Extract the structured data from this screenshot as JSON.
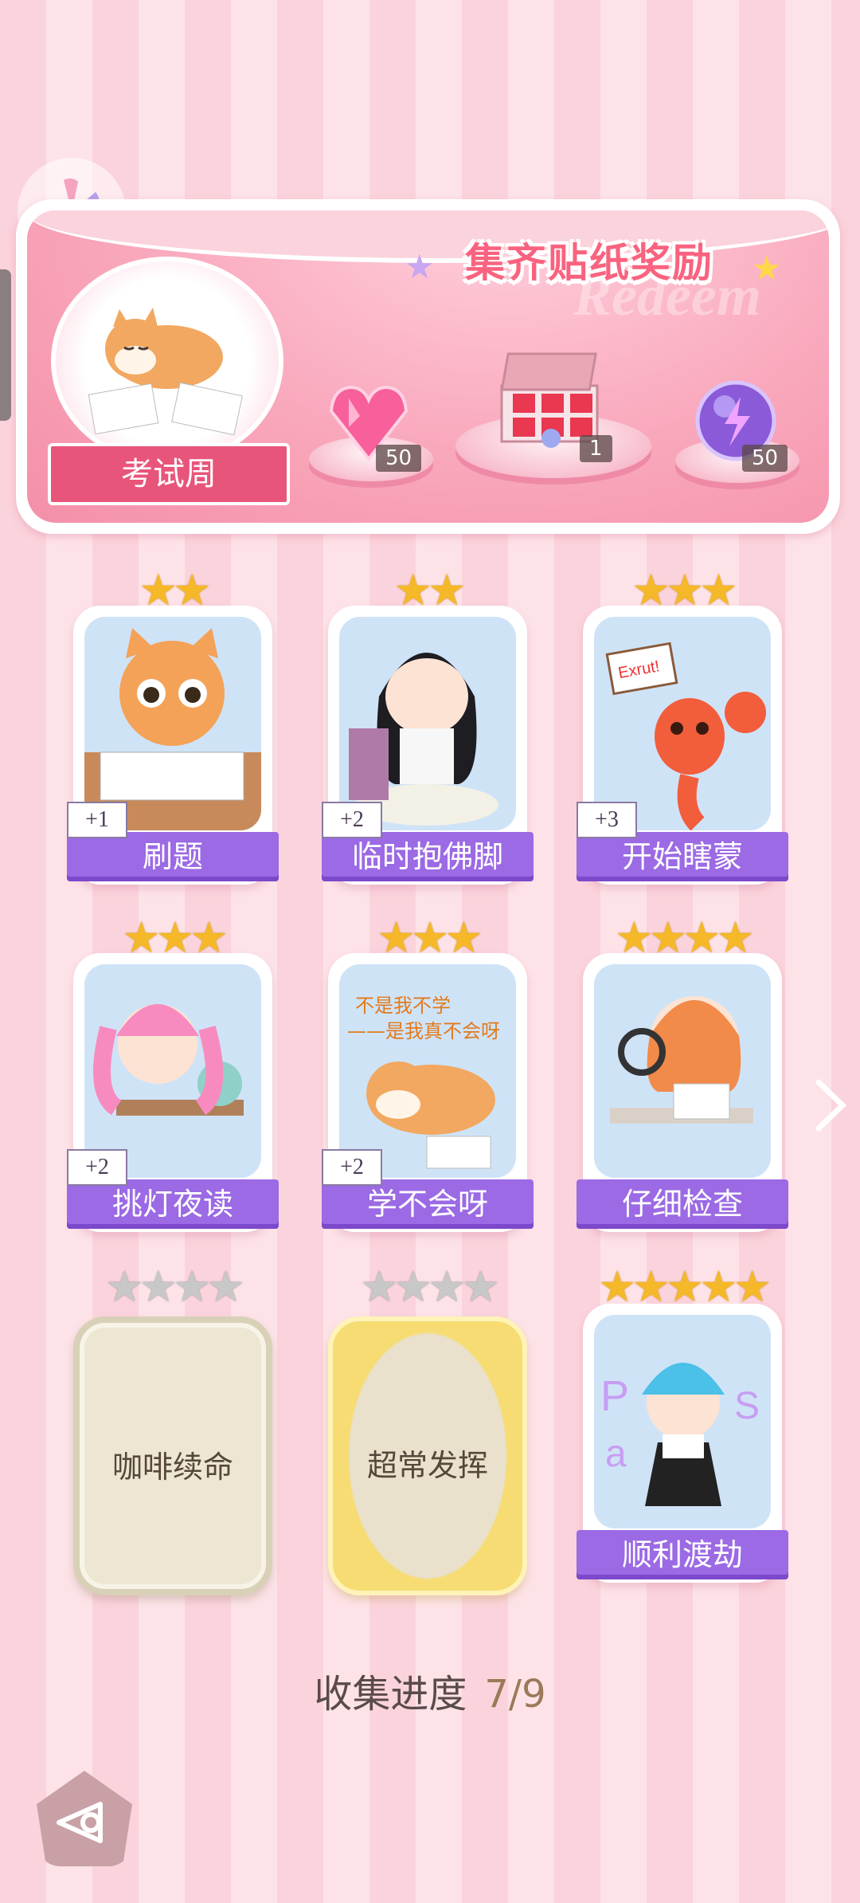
{
  "banner": {
    "title": "集齐贴纸奖励",
    "watermark": "Redeem",
    "theme_label": "考试周",
    "rewards": [
      {
        "icon": "pink-diamond-icon",
        "count": "50"
      },
      {
        "icon": "gift-box-icon",
        "count": "1"
      },
      {
        "icon": "energy-orb-icon",
        "count": "50"
      }
    ]
  },
  "cards": [
    {
      "label": "刷题",
      "bonus": "+1",
      "stars_filled": 2,
      "stars_total": 2,
      "collected": true
    },
    {
      "label": "临时抱佛脚",
      "bonus": "+2",
      "stars_filled": 2,
      "stars_total": 2,
      "collected": true
    },
    {
      "label": "开始瞎蒙",
      "bonus": "+3",
      "stars_filled": 3,
      "stars_total": 3,
      "collected": true
    },
    {
      "label": "挑灯夜读",
      "bonus": "+2",
      "stars_filled": 3,
      "stars_total": 3,
      "collected": true
    },
    {
      "label": "学不会呀",
      "bonus": "+2",
      "stars_filled": 3,
      "stars_total": 3,
      "collected": true,
      "sticker_text": [
        "不是我不学",
        "——是我真不会呀"
      ]
    },
    {
      "label": "仔细检查",
      "bonus": "",
      "stars_filled": 4,
      "stars_total": 4,
      "collected": true
    },
    {
      "label": "咖啡续命",
      "bonus": "",
      "stars_filled": 0,
      "stars_total": 4,
      "collected": false
    },
    {
      "label": "超常发挥",
      "bonus": "",
      "stars_filled": 0,
      "stars_total": 4,
      "collected": false
    },
    {
      "label": "顺利渡劫",
      "bonus": "",
      "stars_filled": 5,
      "stars_total": 5,
      "collected": true
    }
  ],
  "lobster_sign": "Exrut!",
  "progress": {
    "label": "收集进度",
    "value": "7/9"
  },
  "colors": {
    "accent_purple": "#9b6ae4",
    "banner_pink": "#f48fa9",
    "title_pink": "#f9637f",
    "star_gold": "#f4b829"
  }
}
